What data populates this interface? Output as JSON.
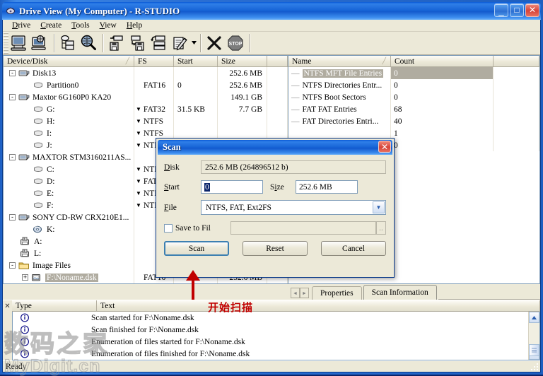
{
  "window": {
    "title": "Drive View (My Computer) - R-STUDIO",
    "minimize_label": "_",
    "maximize_label": "□",
    "close_label": "✕"
  },
  "menu": {
    "items": [
      {
        "accel": "D",
        "rest": "rive"
      },
      {
        "accel": "C",
        "rest": "reate"
      },
      {
        "accel": "T",
        "rest": "ools"
      },
      {
        "accel": "V",
        "rest": "iew"
      },
      {
        "accel": "H",
        "rest": "elp"
      }
    ]
  },
  "toolbar": {
    "tools": [
      {
        "name": "open-drive-files-icon"
      },
      {
        "name": "open-drive-image-icon"
      },
      {
        "name": "create-image-icon"
      },
      {
        "name": "scan-icon"
      },
      {
        "name": "open-image-icon"
      },
      {
        "name": "save-scan-info-icon"
      },
      {
        "name": "recover-icon"
      },
      {
        "name": "view-edit-icon"
      },
      {
        "name": "dropdown-arrow-icon"
      },
      {
        "name": "close-x-icon"
      },
      {
        "name": "stop-icon"
      }
    ]
  },
  "left_panel": {
    "columns": [
      "Device/Disk",
      "FS",
      "Start",
      "Size"
    ],
    "sort_mark": "╱",
    "rows": [
      {
        "indent": 0,
        "toggle": "-",
        "icon": "disk-icon",
        "name": "Disk13",
        "fs": "",
        "start": "",
        "size": "252.6 MB",
        "selected": false
      },
      {
        "indent": 1,
        "toggle": "",
        "icon": "partition-icon",
        "name": "Partition0",
        "fs": "FAT16",
        "start": "0",
        "size": "252.6 MB",
        "selected": false
      },
      {
        "indent": 0,
        "toggle": "-",
        "icon": "disk-icon",
        "name": "Maxtor 6G160P0 KA20",
        "fs": "",
        "start": "",
        "size": "149.1 GB",
        "selected": false
      },
      {
        "indent": 1,
        "toggle": "",
        "icon": "partition-icon",
        "name": "G:",
        "fs": "FAT32",
        "start": "31.5 KB",
        "size": "7.7 GB",
        "selected": false,
        "fs_dropdown": true
      },
      {
        "indent": 1,
        "toggle": "",
        "icon": "partition-icon",
        "name": "H:",
        "fs": "NTFS",
        "start": "",
        "size": "",
        "selected": false,
        "fs_dropdown": true
      },
      {
        "indent": 1,
        "toggle": "",
        "icon": "partition-icon",
        "name": "I:",
        "fs": "NTFS",
        "start": "",
        "size": "",
        "selected": false,
        "fs_dropdown": true
      },
      {
        "indent": 1,
        "toggle": "",
        "icon": "partition-icon",
        "name": "J:",
        "fs": "NTFS",
        "start": "",
        "size": "",
        "selected": false,
        "fs_dropdown": true
      },
      {
        "indent": 0,
        "toggle": "-",
        "icon": "disk-icon",
        "name": "MAXTOR STM3160211AS...",
        "fs": "",
        "start": "",
        "size": "",
        "selected": false
      },
      {
        "indent": 1,
        "toggle": "",
        "icon": "partition-icon",
        "name": "C:",
        "fs": "NTFS",
        "start": "",
        "size": "",
        "selected": false,
        "fs_dropdown": true
      },
      {
        "indent": 1,
        "toggle": "",
        "icon": "partition-icon",
        "name": "D:",
        "fs": "FAT32",
        "start": "",
        "size": "",
        "selected": false,
        "fs_dropdown": true
      },
      {
        "indent": 1,
        "toggle": "",
        "icon": "partition-icon",
        "name": "E:",
        "fs": "NTFS",
        "start": "",
        "size": "",
        "selected": false,
        "fs_dropdown": true
      },
      {
        "indent": 1,
        "toggle": "",
        "icon": "partition-icon",
        "name": "F:",
        "fs": "NTFS",
        "start": "",
        "size": "",
        "selected": false,
        "fs_dropdown": true
      },
      {
        "indent": 0,
        "toggle": "-",
        "icon": "disk-icon",
        "name": "SONY CD-RW CRX210E1...",
        "fs": "",
        "start": "",
        "size": "",
        "selected": false
      },
      {
        "indent": 1,
        "toggle": "",
        "icon": "cdrom-icon",
        "name": "K:",
        "fs": "",
        "start": "",
        "size": "",
        "selected": false
      },
      {
        "indent": 0,
        "toggle": "",
        "icon": "floppy-icon",
        "name": "A:",
        "fs": "",
        "start": "",
        "size": "",
        "selected": false
      },
      {
        "indent": 0,
        "toggle": "",
        "icon": "floppy-icon",
        "name": "L:",
        "fs": "",
        "start": "",
        "size": "",
        "selected": false
      },
      {
        "indent": 0,
        "toggle": "-",
        "icon": "folder-icon",
        "name": "Image Files",
        "fs": "",
        "start": "",
        "size": "",
        "selected": false
      },
      {
        "indent": 1,
        "toggle": "+",
        "icon": "image-file-icon",
        "name": "F:\\Noname.dsk",
        "fs": "FAT16",
        "start": "",
        "size": "252.6 MB",
        "selected": true
      }
    ]
  },
  "right_panel": {
    "columns": [
      "Name",
      "Count"
    ],
    "sort_mark": "╱",
    "rows": [
      {
        "name": "NTFS MFT File Entries",
        "count": "0",
        "selected": true
      },
      {
        "name": "NTFS Directories Entr...",
        "count": "0",
        "selected": false
      },
      {
        "name": "NTFS Boot Sectors",
        "count": "0",
        "selected": false
      },
      {
        "name": "FAT FAT Entries",
        "count": "68",
        "selected": false
      },
      {
        "name": "FAT Directories Entri...",
        "count": "40",
        "selected": false
      },
      {
        "name": "",
        "count": "1",
        "selected": false
      },
      {
        "name": "",
        "count": "0",
        "selected": false
      }
    ]
  },
  "tabs": {
    "prev_label": "◄",
    "next_label": "►",
    "items": [
      {
        "label": "Properties",
        "active": false
      },
      {
        "label": "Scan Information",
        "active": true
      }
    ]
  },
  "log_panel": {
    "close_label": "✕",
    "columns": [
      "Type",
      "Text"
    ],
    "rows": [
      {
        "icon": "info-icon",
        "type": "",
        "text": "Scan started for F:\\Noname.dsk"
      },
      {
        "icon": "info-icon",
        "type": "",
        "text": "Scan finished for F:\\Noname.dsk"
      },
      {
        "icon": "info-icon",
        "type": "",
        "text": "Enumeration of files started for F:\\Noname.dsk"
      },
      {
        "icon": "info-icon",
        "type": "",
        "text": "Enumeration of files finished for F:\\Noname.dsk"
      }
    ]
  },
  "status_bar": {
    "text": "Ready"
  },
  "dialog": {
    "title": "Scan",
    "close_label": "✕",
    "disk": {
      "accel": "D",
      "rest": "isk",
      "value": "252.6 MB (264896512 b)"
    },
    "start": {
      "accel": "S",
      "rest": "tart",
      "value": "0"
    },
    "size": {
      "accel": "i",
      "pre": "S",
      "rest": "ze",
      "value": "252.6 MB"
    },
    "file": {
      "accel": "F",
      "rest": "ile",
      "value": "NTFS, FAT, Ext2FS",
      "arrow": "▼"
    },
    "save_to_file": {
      "pre": "Save ",
      "accel": "t",
      "rest": "o Fil",
      "value": "",
      "browse_label": "..",
      "checked": false
    },
    "buttons": [
      {
        "label": "Scan",
        "default": true
      },
      {
        "label": "Reset",
        "default": false
      },
      {
        "label": "Cancel",
        "default": false
      }
    ]
  },
  "annotation": {
    "note": "开始扫描",
    "arrow_color": "#c00000"
  },
  "watermark": {
    "line1": "数码之家",
    "line2": "MyDigit.cn"
  }
}
